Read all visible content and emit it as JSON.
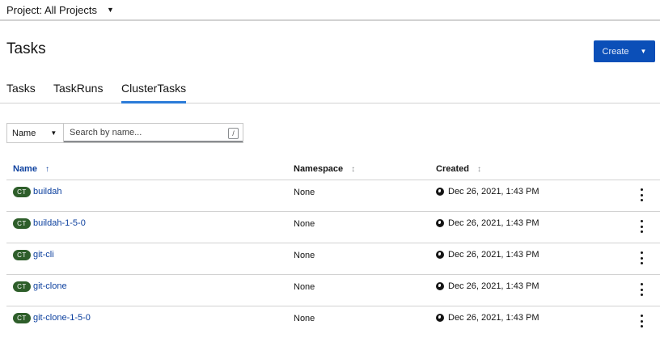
{
  "project": {
    "label": "Project: All Projects"
  },
  "page": {
    "title": "Tasks",
    "create_label": "Create"
  },
  "tabs": [
    {
      "label": "Tasks"
    },
    {
      "label": "TaskRuns"
    },
    {
      "label": "ClusterTasks",
      "active": true
    }
  ],
  "filter": {
    "type_label": "Name",
    "placeholder": "Search by name...",
    "shortcut": "/"
  },
  "table": {
    "columns": [
      {
        "label": "Name",
        "sort": "↑"
      },
      {
        "label": "Namespace",
        "sort": "↕"
      },
      {
        "label": "Created",
        "sort": "↕"
      }
    ],
    "rows": [
      {
        "badge": "CT",
        "name": "buildah",
        "namespace": "None",
        "created": "Dec 26, 2021, 1:43 PM"
      },
      {
        "badge": "CT",
        "name": "buildah-1-5-0",
        "namespace": "None",
        "created": "Dec 26, 2021, 1:43 PM"
      },
      {
        "badge": "CT",
        "name": "git-cli",
        "namespace": "None",
        "created": "Dec 26, 2021, 1:43 PM"
      },
      {
        "badge": "CT",
        "name": "git-clone",
        "namespace": "None",
        "created": "Dec 26, 2021, 1:43 PM"
      },
      {
        "badge": "CT",
        "name": "git-clone-1-5-0",
        "namespace": "None",
        "created": "Dec 26, 2021, 1:43 PM"
      }
    ]
  },
  "colors": {
    "accent": "#0b4fb8",
    "link": "#0b3f9e",
    "badge": "#2e5e2a",
    "tab_active": "#2b7bd8"
  }
}
